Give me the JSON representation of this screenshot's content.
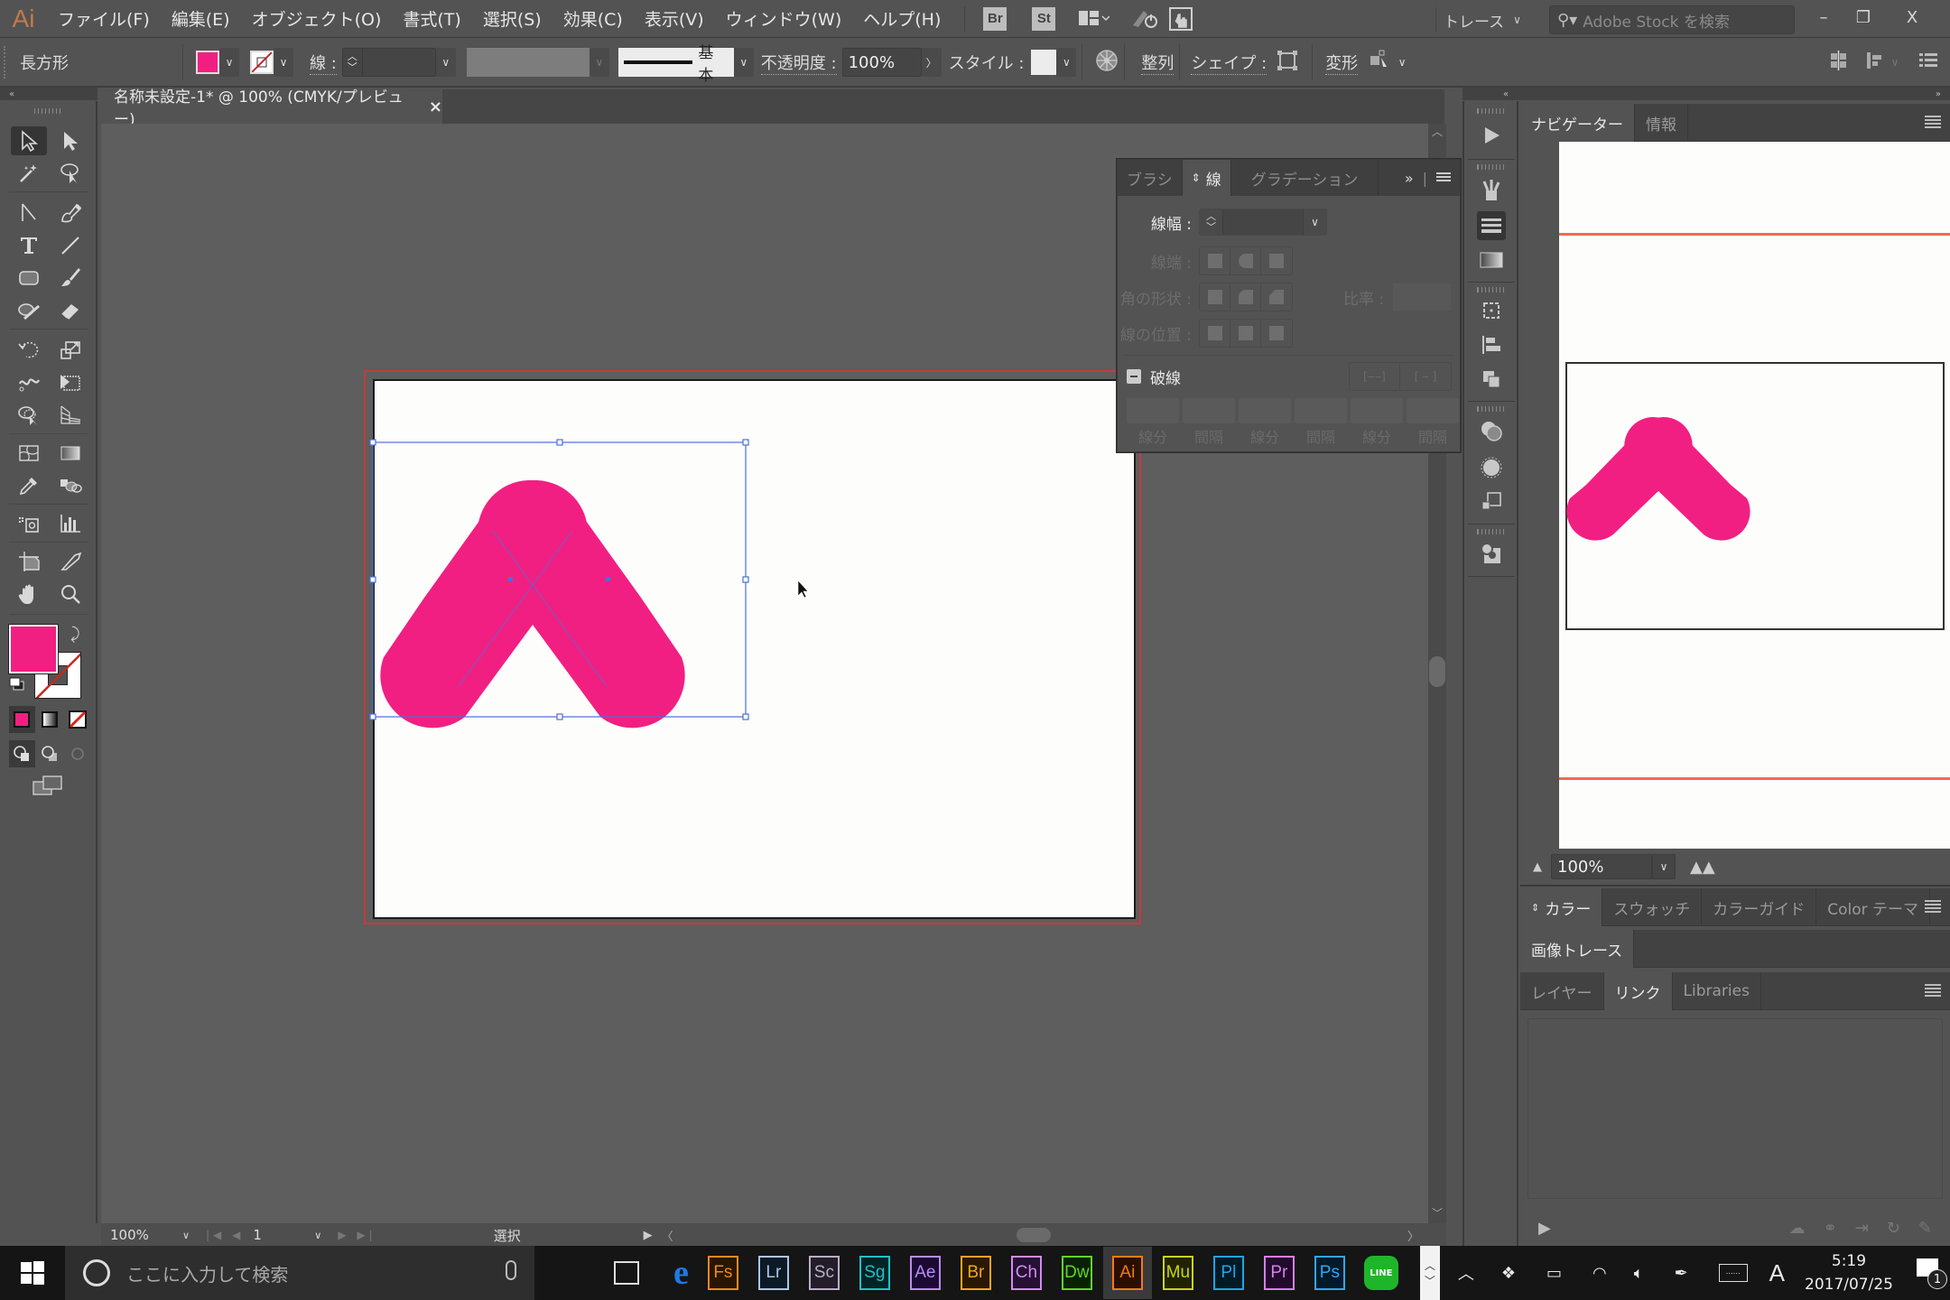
{
  "app": {
    "logo": "Ai",
    "menus": [
      "ファイル(F)",
      "編集(E)",
      "オブジェクト(O)",
      "書式(T)",
      "選択(S)",
      "効果(C)",
      "表示(V)",
      "ウィンドウ(W)",
      "ヘルプ(H)"
    ],
    "bridge_btn": "Br",
    "stock_btn": "St",
    "workspace": "トレース",
    "stock_search_placeholder": "Adobe Stock を検索",
    "window_controls": {
      "minimize": "–",
      "restore": "❐",
      "close": "X"
    }
  },
  "control_bar": {
    "selection_type": "長方形",
    "fill_color": "#f21f82",
    "stroke_label": "線 :",
    "stroke_width": "",
    "stroke_profile": "基本",
    "opacity_label": "不透明度 :",
    "opacity_value": "100%",
    "style_label": "スタイル :",
    "align_label": "整列",
    "shape_label": "シェイプ :",
    "transform_label": "変形"
  },
  "document_tab": {
    "title": "名称未設定-1* @ 100% (CMYK/プレビュー)",
    "close": "×"
  },
  "tools": {
    "fill_color": "#f21f82",
    "stroke": "none"
  },
  "artwork": {
    "fill": "#f21f82",
    "selection_color": "#4b6fd8",
    "shape": "two crossing rounded bars forming an inverted V"
  },
  "stroke_panel": {
    "tabs": [
      "ブラシ",
      "線",
      "グラデーション"
    ],
    "active_tab": 1,
    "weight_label": "線幅 :",
    "weight_value": "",
    "cap_label": "線端 :",
    "corner_label": "角の形状 :",
    "limit_label": "比率 :",
    "align_label": "線の位置 :",
    "dashed_label": "破線",
    "dash_labels": [
      "線分",
      "間隔",
      "線分",
      "間隔",
      "線分",
      "間隔"
    ]
  },
  "navigator_panel": {
    "tabs": [
      "ナビゲーター",
      "情報"
    ],
    "active_tab": 0,
    "zoom_value": "100%"
  },
  "color_panel": {
    "tabs": [
      "カラー",
      "スウォッチ",
      "カラーガイド",
      "Color テーマ"
    ],
    "active_tab": 0
  },
  "image_trace_panel": {
    "tabs": [
      "画像トレース"
    ]
  },
  "links_panel": {
    "tabs": [
      "レイヤー",
      "リンク",
      "Libraries"
    ],
    "active_tab": 1
  },
  "status_bar": {
    "zoom": "100%",
    "artboard_number": "1",
    "status_text": "選択"
  },
  "taskbar": {
    "search_placeholder": "ここに入力して検索",
    "apps": [
      {
        "label": "Fs",
        "color": "#f08a1c",
        "bg": "#2a1600"
      },
      {
        "label": "Lr",
        "color": "#a9c7e6",
        "bg": "#0c1a26"
      },
      {
        "label": "Sc",
        "color": "#b8aec6",
        "bg": "#221d28"
      },
      {
        "label": "Sg",
        "color": "#1fc2c9",
        "bg": "#002326"
      },
      {
        "label": "Ae",
        "color": "#b98cf2",
        "bg": "#1c0a33"
      },
      {
        "label": "Br",
        "color": "#f0a521",
        "bg": "#2a1900"
      },
      {
        "label": "Ch",
        "color": "#d18cf0",
        "bg": "#261033"
      },
      {
        "label": "Dw",
        "color": "#5dd62a",
        "bg": "#0a2100"
      },
      {
        "label": "Ai",
        "color": "#f47b16",
        "bg": "#2a0f00"
      },
      {
        "label": "Mu",
        "color": "#c9d41f",
        "bg": "#212300"
      },
      {
        "label": "Pl",
        "color": "#1fa5e6",
        "bg": "#001a26"
      },
      {
        "label": "Pr",
        "color": "#d97ef2",
        "bg": "#220a2b"
      },
      {
        "label": "Ps",
        "color": "#2fa8f2",
        "bg": "#001a2b"
      }
    ],
    "line_label": "LINE",
    "time": "5:19",
    "date": "2017/07/25",
    "ime": "A",
    "notification_count": "1"
  }
}
